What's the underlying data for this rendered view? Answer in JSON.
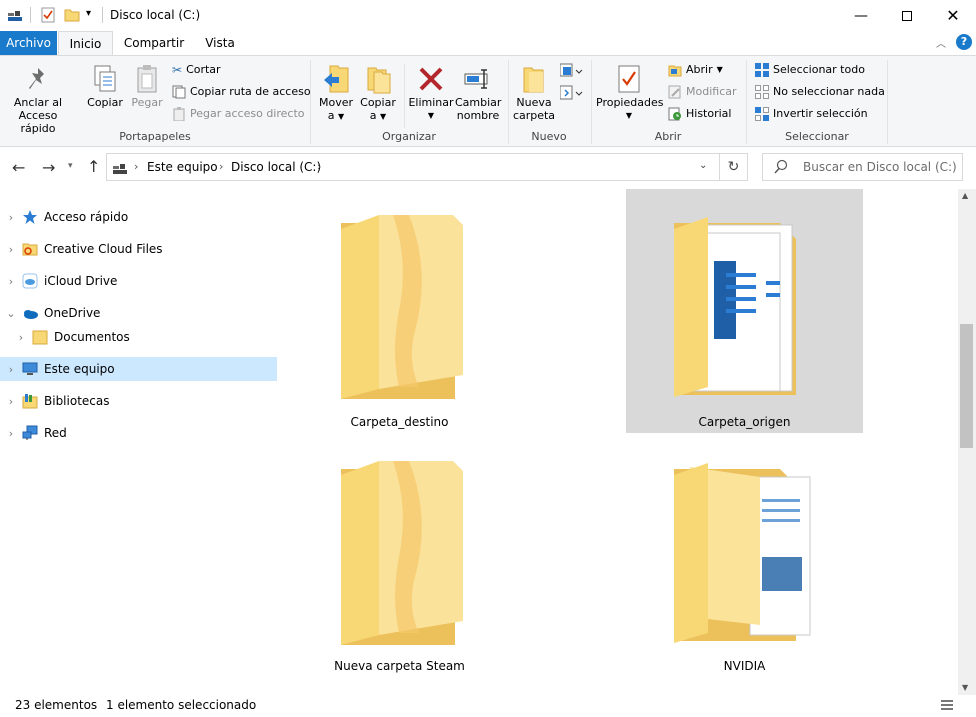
{
  "window": {
    "title": "Disco local (C:)"
  },
  "tabs": {
    "archivo": "Archivo",
    "inicio": "Inicio",
    "compartir": "Compartir",
    "vista": "Vista"
  },
  "ribbon": {
    "portapapeles": {
      "anclar": "Anclar al\nAcceso rápido",
      "anclar_l1": "Anclar al",
      "anclar_l2": "Acceso rápido",
      "copiar": "Copiar",
      "pegar": "Pegar",
      "cortar": "Cortar",
      "copiar_ruta": "Copiar ruta de acceso",
      "pegar_acceso": "Pegar acceso directo",
      "group": "Portapapeles"
    },
    "organizar": {
      "mover_l1": "Mover",
      "mover_l2": "a",
      "copiar_l1": "Copiar",
      "copiar_l2": "a",
      "eliminar": "Eliminar",
      "cambiar_l1": "Cambiar",
      "cambiar_l2": "nombre",
      "group": "Organizar"
    },
    "nuevo": {
      "nueva_l1": "Nueva",
      "nueva_l2": "carpeta",
      "group": "Nuevo"
    },
    "abrir": {
      "propiedades": "Propiedades",
      "abrir": "Abrir",
      "modificar": "Modificar",
      "historial": "Historial",
      "group": "Abrir"
    },
    "seleccionar": {
      "todo": "Seleccionar todo",
      "nada": "No seleccionar nada",
      "invertir": "Invertir selección",
      "group": "Seleccionar"
    }
  },
  "address": {
    "crumbs": [
      "Este equipo",
      "Disco local (C:)"
    ],
    "search_placeholder": "Buscar en Disco local (C:)"
  },
  "nav": [
    {
      "label": "Acceso rápido",
      "icon": "star-icon"
    },
    {
      "label": "Creative Cloud Files",
      "icon": "creative-cloud-icon"
    },
    {
      "label": "iCloud Drive",
      "icon": "icloud-icon"
    },
    {
      "label": "OneDrive",
      "icon": "onedrive-icon"
    },
    {
      "label": "Documentos",
      "icon": "folder-icon"
    },
    {
      "label": "Este equipo",
      "icon": "computer-icon"
    },
    {
      "label": "Bibliotecas",
      "icon": "libraries-icon"
    },
    {
      "label": "Red",
      "icon": "network-icon"
    }
  ],
  "items": [
    {
      "name": "Carpeta_destino",
      "icon": "folder-icon"
    },
    {
      "name": "Carpeta_origen",
      "icon": "folder-documents-icon",
      "selected": true
    },
    {
      "name": "Nueva carpeta Steam",
      "icon": "folder-icon"
    },
    {
      "name": "NVIDIA",
      "icon": "folder-documents-icon"
    }
  ],
  "status": {
    "count": "23 elementos",
    "selected": "1 elemento seleccionado"
  },
  "colors": {
    "accent": "#1979ca",
    "selection": "#cce8ff",
    "folder": "#f8d775"
  }
}
